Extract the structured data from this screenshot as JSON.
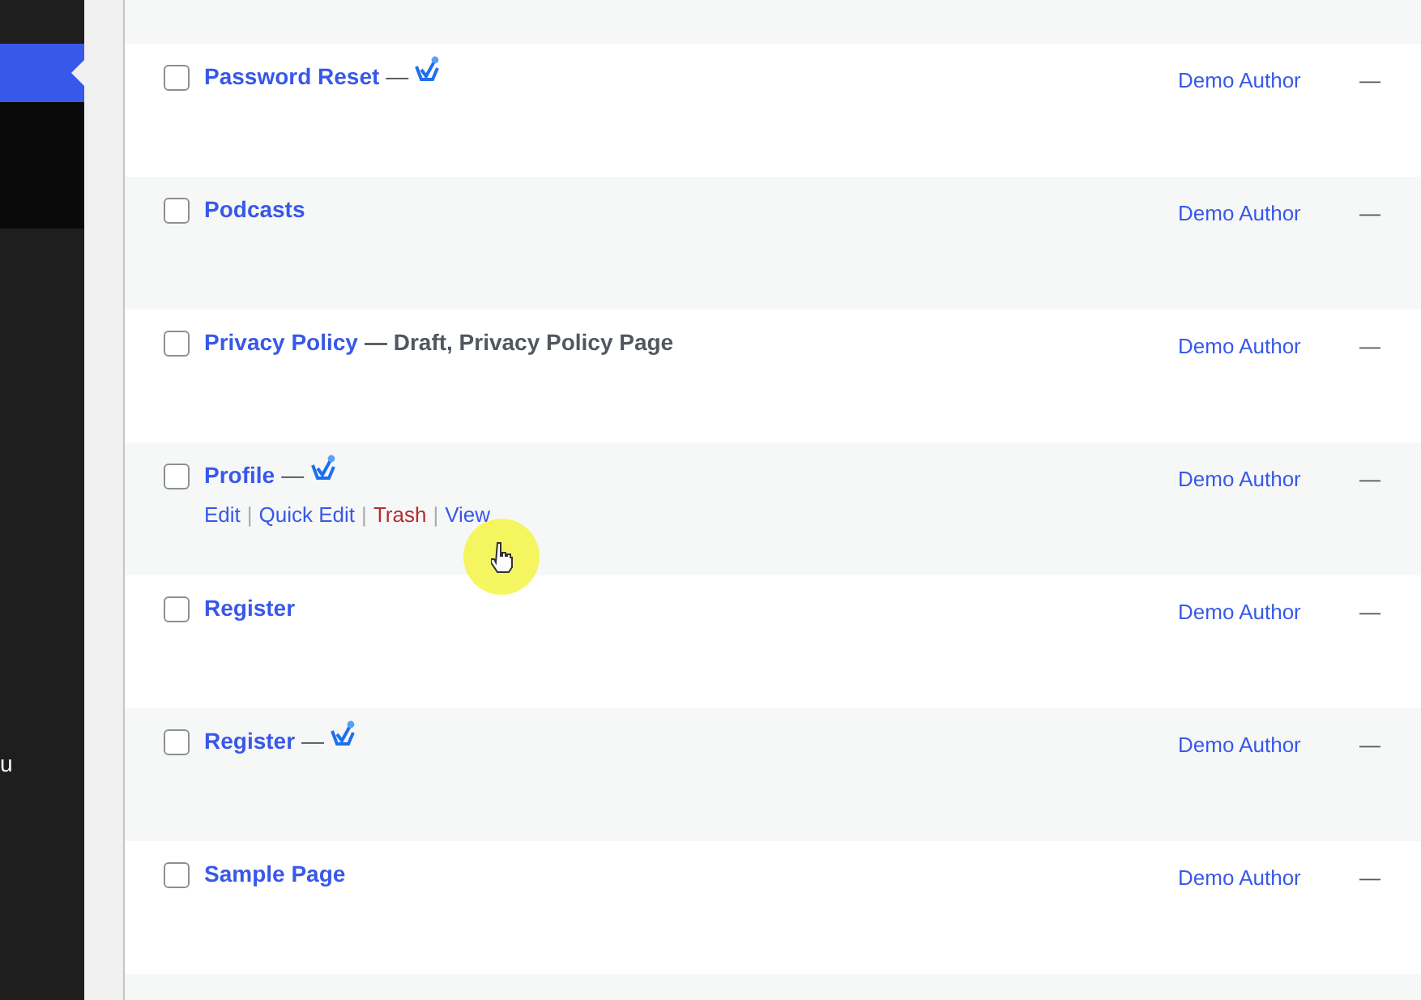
{
  "sidebar": {
    "active_item": true,
    "cut_text": "u"
  },
  "rows": [
    {
      "checked": false,
      "title": "Password Reset",
      "dash": "—",
      "icon": true,
      "author": "Demo Author",
      "date": "—"
    },
    {
      "checked": false,
      "title": "Podcasts",
      "author": "Demo Author",
      "date": "—"
    },
    {
      "checked": false,
      "title": "Privacy Policy",
      "post_state": "— Draft, Privacy Policy Page",
      "author": "Demo Author",
      "date": "—"
    },
    {
      "checked": false,
      "title": "Profile",
      "dash": "—",
      "icon": true,
      "author": "Demo Author",
      "date": "—",
      "separator": "|",
      "actions": [
        {
          "label": "Edit",
          "kind": "link"
        },
        {
          "label": "Quick Edit",
          "kind": "link"
        },
        {
          "label": "Trash",
          "kind": "delete"
        },
        {
          "label": "View",
          "kind": "link"
        }
      ]
    },
    {
      "checked": false,
      "title": "Register",
      "author": "Demo Author",
      "date": "—"
    },
    {
      "checked": false,
      "title": "Register",
      "dash": "—",
      "icon": true,
      "author": "Demo Author",
      "date": "—"
    },
    {
      "checked": false,
      "title": "Sample Page",
      "author": "Demo Author",
      "date": "—"
    }
  ]
}
